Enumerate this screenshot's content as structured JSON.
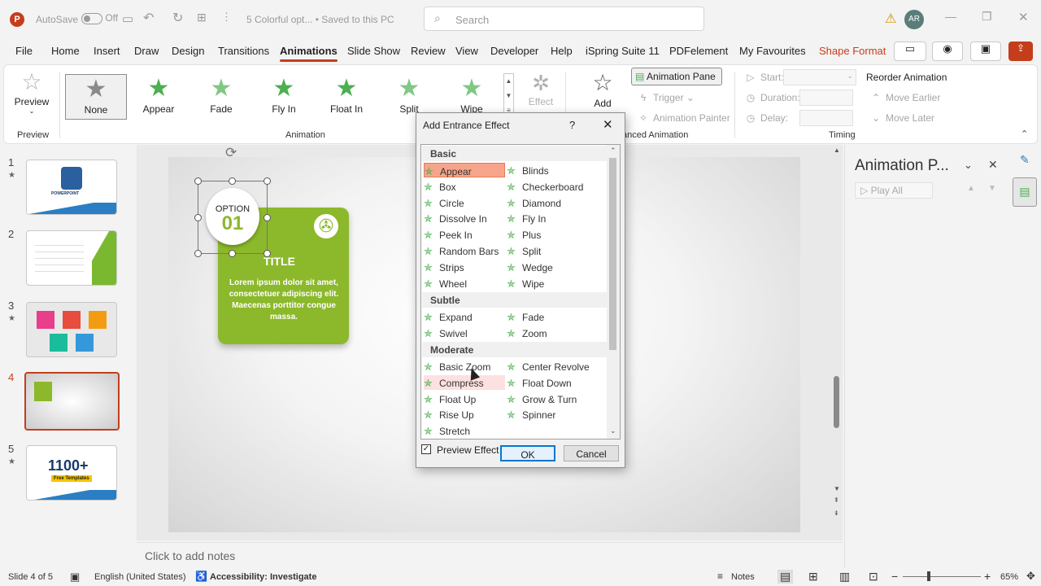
{
  "titlebar": {
    "autosave_label": "AutoSave",
    "autosave_state": "Off",
    "filename": "5 Colorful opt...  •  Saved to this PC",
    "search_placeholder": "Search",
    "user_initials": "AR"
  },
  "menu": {
    "tabs": [
      "File",
      "Home",
      "Insert",
      "Draw",
      "Design",
      "Transitions",
      "Animations",
      "Slide Show",
      "Review",
      "View",
      "Developer",
      "Help",
      "iSpring Suite 11",
      "PDFelement",
      "My Favourites",
      "Shape Format"
    ],
    "active": "Animations"
  },
  "ribbon": {
    "preview_label": "Preview",
    "preview_group": "Preview",
    "animation_group": "Animation",
    "gallery": [
      "None",
      "Appear",
      "Fade",
      "Fly In",
      "Float In",
      "Split",
      "Wipe"
    ],
    "effect_label": "Effect",
    "add_label": "Add",
    "animation_pane_btn": "Animation Pane",
    "trigger_label": "Trigger",
    "animation_painter": "Animation Painter",
    "advanced_group": "anced Animation",
    "start_label": "Start:",
    "duration_label": "Duration:",
    "delay_label": "Delay:",
    "reorder_label": "Reorder Animation",
    "move_earlier": "Move Earlier",
    "move_later": "Move Later",
    "timing_group": "Timing"
  },
  "thumbnails": [
    {
      "num": "1",
      "star": true,
      "text": "POWERPOINT"
    },
    {
      "num": "2",
      "star": false,
      "text": ""
    },
    {
      "num": "3",
      "star": true,
      "text": ""
    },
    {
      "num": "4",
      "star": false,
      "text": ""
    },
    {
      "num": "5",
      "star": true,
      "text": "1100+",
      "sub": "Free Templates"
    }
  ],
  "slide": {
    "option_label": "OPTION",
    "option_number": "01",
    "card_title": "TITLE",
    "card_body": "Lorem ipsum dolor sit amet, consectetuer adipiscing elit. Maecenas porttitor congue massa."
  },
  "notes_placeholder": "Click to add notes",
  "anim_pane": {
    "title": "Animation P...",
    "play_all": "Play All"
  },
  "dialog": {
    "title": "Add Entrance Effect",
    "help": "?",
    "categories": {
      "basic": "Basic",
      "subtle": "Subtle",
      "moderate": "Moderate"
    },
    "basic_left": [
      "Appear",
      "Box",
      "Circle",
      "Dissolve In",
      "Peek In",
      "Random Bars",
      "Strips",
      "Wheel"
    ],
    "basic_right": [
      "Blinds",
      "Checkerboard",
      "Diamond",
      "Fly In",
      "Plus",
      "Split",
      "Wedge",
      "Wipe"
    ],
    "subtle_left": [
      "Expand",
      "Swivel"
    ],
    "subtle_right": [
      "Fade",
      "Zoom"
    ],
    "moderate_left": [
      "Basic Zoom",
      "Compress",
      "Float Up",
      "Rise Up",
      "Stretch"
    ],
    "moderate_right": [
      "Center Revolve",
      "Float Down",
      "Grow & Turn",
      "Spinner"
    ],
    "selected": "Appear",
    "preview_effect": "Preview Effect",
    "preview_checked": true,
    "ok": "OK",
    "cancel": "Cancel"
  },
  "status": {
    "slide_info": "Slide 4 of 5",
    "language": "English (United States)",
    "accessibility": "Accessibility: Investigate",
    "notes": "Notes",
    "zoom": "65%"
  },
  "colors": {
    "accent": "#c43e1c",
    "card_green": "#8cb82b",
    "star_green": "#4caf50",
    "selection": "#f6a58b"
  }
}
